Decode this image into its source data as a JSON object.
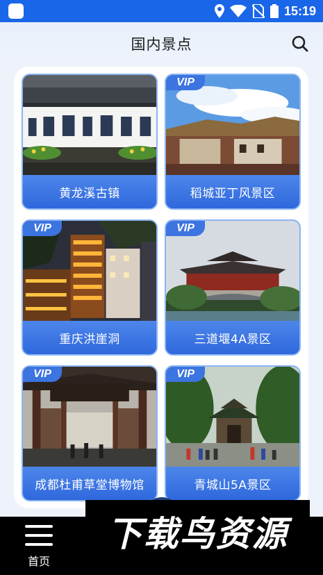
{
  "status_bar": {
    "time": "15:19",
    "icons": [
      "app-icon",
      "location-icon",
      "wifi-icon",
      "no-sim-icon",
      "battery-icon"
    ]
  },
  "header": {
    "title": "国内景点",
    "search_icon": "search-icon"
  },
  "vip_label": "VIP",
  "spots": [
    {
      "name": "黄龙溪古镇",
      "vip": false
    },
    {
      "name": "稻城亚丁风景区",
      "vip": true
    },
    {
      "name": "重庆洪崖洞",
      "vip": true
    },
    {
      "name": "三道堰4A景区",
      "vip": true
    },
    {
      "name": "成都杜甫草堂博物馆",
      "vip": true
    },
    {
      "name": "青城山5A景区",
      "vip": true
    }
  ],
  "bottom_nav": {
    "home_label": "首页",
    "home_icon": "menu-icon"
  },
  "watermark": "下载鸟资源",
  "colors": {
    "primary": "#1a66e8",
    "card_caption": "#3c74e0",
    "background": "#eef3fb"
  }
}
